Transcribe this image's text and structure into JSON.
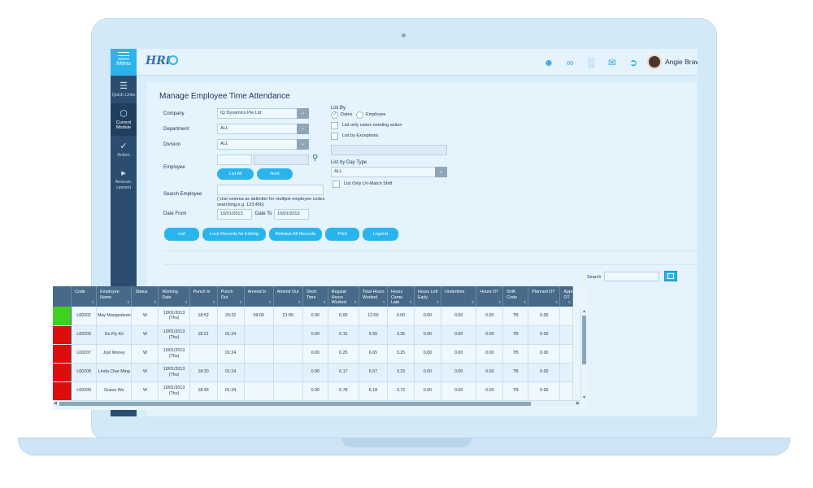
{
  "app": {
    "menu_label": "Menu",
    "logo_text": "HRi",
    "user_name": "Angie Brawn",
    "colors": {
      "accent": "#29b4ee",
      "sidebar": "#2b4e70",
      "table_header": "#466a88",
      "status_green": "#3ed11f",
      "status_red": "#dc0d0d"
    }
  },
  "sidenav": {
    "items": [
      {
        "label": "Quick Links",
        "icon": "list-icon"
      },
      {
        "label": "Current Module",
        "icon": "cube-icon"
      },
      {
        "label": "Action",
        "icon": "check-circle-icon"
      },
      {
        "label": "Announ-cement",
        "icon": "megaphone-icon"
      }
    ]
  },
  "topbar": {
    "icons": [
      "user-icon",
      "attachment-icon",
      "chart-icon",
      "mail-icon",
      "logout-icon"
    ]
  },
  "page": {
    "title": "Manage Employee Time Attendance"
  },
  "form": {
    "company_label": "Company",
    "company_value": "IQ Dynamics Pte Ltd",
    "department_label": "Department",
    "department_value": "ALL",
    "division_label": "Division",
    "division_value": "ALL",
    "employee_label": "Employee",
    "list_all_label": "List All",
    "next_label": "Next",
    "search_employee_label": "Search Employee",
    "search_hint_1": "( Use comma as delimiter for multiple employee codes",
    "search_hint_2": "searching,e.g. 123,456)",
    "date_from_label": "Date From",
    "date_from_value": "10/01/2013",
    "date_to_label": "Date To",
    "date_to_value": "10/01/2013",
    "list_by_label": "List By",
    "list_by_dates": "Dates",
    "list_by_employee": "Employee",
    "only_action_label": "List only cases needing action",
    "by_exceptions_label": "List by Exceptions",
    "day_type_label": "List by Day Type",
    "day_type_value": "ALL",
    "unmatch_label": "List Only Un-Match Shift"
  },
  "actions": {
    "list": "List",
    "lock": "Lock Records for Editing",
    "release": "Release All Records",
    "print": "Print",
    "legend": "Legend"
  },
  "grid": {
    "search_label": "Search",
    "columns": [
      "",
      "Code",
      "Employee Name",
      "Status",
      "Working Date",
      "Punch In",
      "Punch Out",
      "Amend In",
      "Amend Out",
      "Short Time",
      "Regular Hours Worked",
      "Total Hours Worked",
      "Hours Came Late",
      "Hours Left Early",
      "Undertime",
      "Hours OT",
      "Shift Code",
      "Planned OT",
      "Appr OT"
    ],
    "rows": [
      {
        "flag": "#3ed11f",
        "code": "L00202",
        "name": "May Mangosteen",
        "status": "W",
        "date": "10/01/2013 (Thu)",
        "punch_in": "18:52",
        "punch_out": "20:22",
        "amend_in": "09:00",
        "amend_out": "21:00",
        "short_time": "0.00",
        "regular": "0.00",
        "total": "12:00",
        "late": "0.00",
        "early": "0.00",
        "undertime": "0.00",
        "ot": "0.00",
        "shift": "TB",
        "planned_ot": "0.00"
      },
      {
        "flag": "#dc0d0d",
        "code": "L00203",
        "name": "Go Fly Kit",
        "status": "W",
        "date": "10/01/2013 (Thu)",
        "punch_in": "18:21",
        "punch_out": "01:24",
        "amend_in": "",
        "amend_out": "",
        "short_time": "0.00",
        "regular": "6.15",
        "total": "6.55",
        "late": "3.35",
        "early": "0.00",
        "undertime": "0.00",
        "ot": "0.00",
        "shift": "TB",
        "planned_ot": "0.00"
      },
      {
        "flag": "#dc0d0d",
        "code": "L00207",
        "name": "Jojo Money",
        "status": "W",
        "date": "10/01/2013 (Thu)",
        "punch_in": "",
        "punch_out": "01:24",
        "amend_in": "",
        "amend_out": "",
        "short_time": "0.00",
        "regular": "6.25",
        "total": "6.65",
        "late": "3.25",
        "early": "0.00",
        "undertime": "0.00",
        "ot": "0.00",
        "shift": "TB",
        "planned_ot": "0.00"
      },
      {
        "flag": "#dc0d0d",
        "code": "L00208",
        "name": "Linda Char Ming",
        "status": "W",
        "date": "10/01/2013 (Thu)",
        "punch_in": "18:20",
        "punch_out": "01:24",
        "amend_in": "",
        "amend_out": "",
        "short_time": "0.00",
        "regular": "6.17",
        "total": "6.57",
        "late": "3.33",
        "early": "0.00",
        "undertime": "0.00",
        "ot": "0.00",
        "shift": "TB",
        "planned_ot": "0.00"
      },
      {
        "flag": "#dc0d0d",
        "code": "L00209",
        "name": "Guess Wu",
        "status": "W",
        "date": "10/01/2013 (Thu)",
        "punch_in": "18:43",
        "punch_out": "01:24",
        "amend_in": "",
        "amend_out": "",
        "short_time": "0.00",
        "regular": "5.78",
        "total": "6.18",
        "late": "3.72",
        "early": "0.00",
        "undertime": "0.00",
        "ot": "0.00",
        "shift": "TB",
        "planned_ot": "0.00"
      }
    ]
  }
}
